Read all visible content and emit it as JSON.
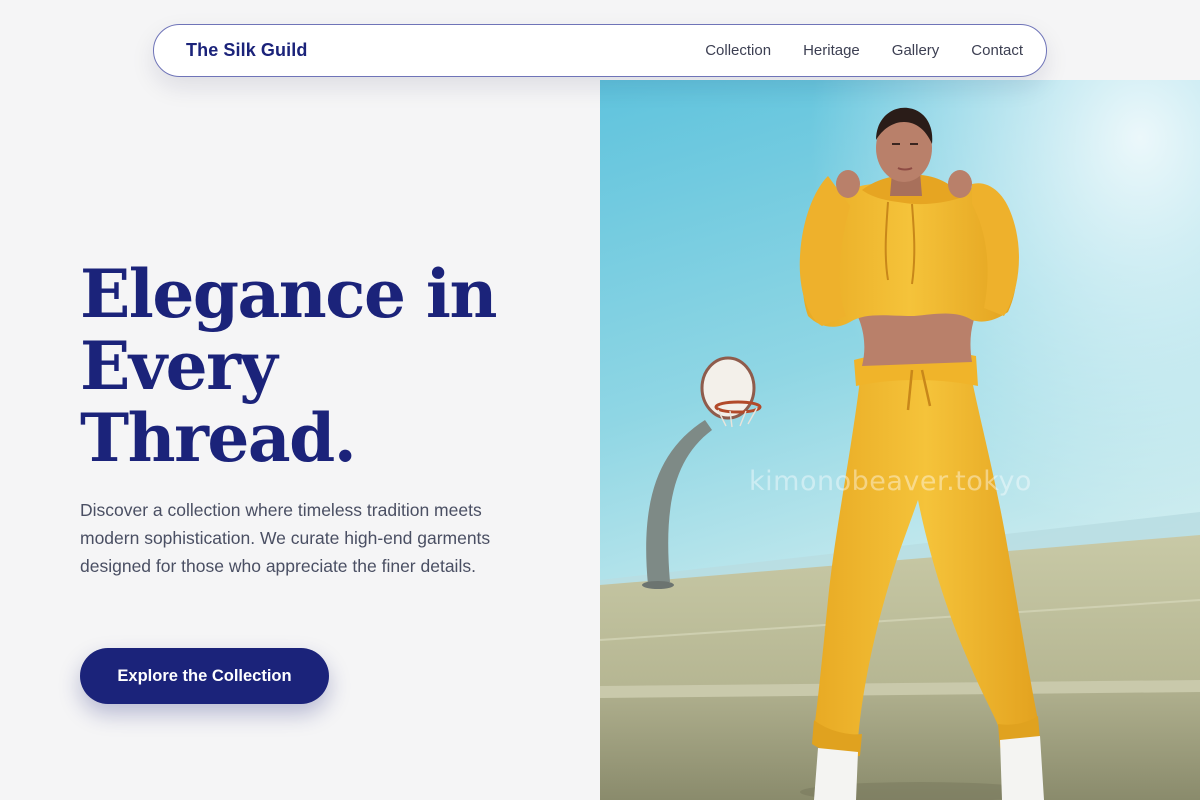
{
  "nav": {
    "brand": "The Silk Guild",
    "links": [
      {
        "label": "Collection"
      },
      {
        "label": "Heritage"
      },
      {
        "label": "Gallery"
      },
      {
        "label": "Contact"
      }
    ]
  },
  "hero": {
    "title_lines": [
      "Elegance in",
      "Every",
      "Thread."
    ],
    "description": "Discover a collection where timeless tradition meets modern sophistication. We curate high-end garments designed for those who appreciate the finer details.",
    "cta_label": "Explore the Collection"
  },
  "image": {
    "watermark": "kimonobeaver.tokyo"
  },
  "colors": {
    "brand": "#1b237a",
    "page_background": "#f5f5f6",
    "body_text": "#4a4f63"
  }
}
